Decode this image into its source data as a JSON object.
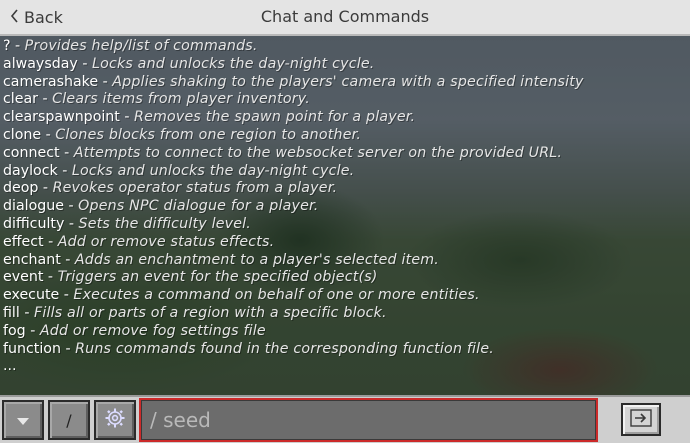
{
  "header": {
    "back_label": "Back",
    "title": "Chat and Commands"
  },
  "chat": {
    "lines": [
      {
        "cmd": "?",
        "desc": "Provides help/list of commands."
      },
      {
        "cmd": "alwaysday",
        "desc": "Locks and unlocks the day-night cycle."
      },
      {
        "cmd": "camerashake",
        "desc": "Applies shaking to the players' camera with a specified intensity"
      },
      {
        "cmd": "clear",
        "desc": "Clears items from player inventory."
      },
      {
        "cmd": "clearspawnpoint",
        "desc": "Removes the spawn point for a player."
      },
      {
        "cmd": "clone",
        "desc": "Clones blocks from one region to another."
      },
      {
        "cmd": "connect",
        "desc": "Attempts to connect to the websocket server on the provided URL."
      },
      {
        "cmd": "daylock",
        "desc": "Locks and unlocks the day-night cycle."
      },
      {
        "cmd": "deop",
        "desc": "Revokes operator status from a player."
      },
      {
        "cmd": "dialogue",
        "desc": "Opens NPC dialogue for a player."
      },
      {
        "cmd": "difficulty",
        "desc": "Sets the difficulty level."
      },
      {
        "cmd": "effect",
        "desc": "Add or remove status effects."
      },
      {
        "cmd": "enchant",
        "desc": "Adds an enchantment to a player's selected item."
      },
      {
        "cmd": "event",
        "desc": "Triggers an event for the specified object(s)"
      },
      {
        "cmd": "execute",
        "desc": "Executes a command on behalf of one or more entities."
      },
      {
        "cmd": "fill",
        "desc": "Fills all or parts of a region with a specific block."
      },
      {
        "cmd": "fog",
        "desc": "Add or remove fog settings file"
      },
      {
        "cmd": "function",
        "desc": "Runs commands found in the corresponding function file."
      }
    ],
    "separator": " - ",
    "ellipsis": "..."
  },
  "input": {
    "value": "",
    "placeholder": "/ seed"
  },
  "toolbar": {
    "slash_label": "/"
  },
  "colors": {
    "input_border": "#cc2a2a",
    "titlebar_bg": "#e4e4e4",
    "button_bg": "#8b8b8b"
  },
  "icons": {
    "dropdown": "chevron-down-icon",
    "settings": "gear-icon",
    "send": "send-arrow-icon",
    "back": "chevron-left-icon"
  }
}
